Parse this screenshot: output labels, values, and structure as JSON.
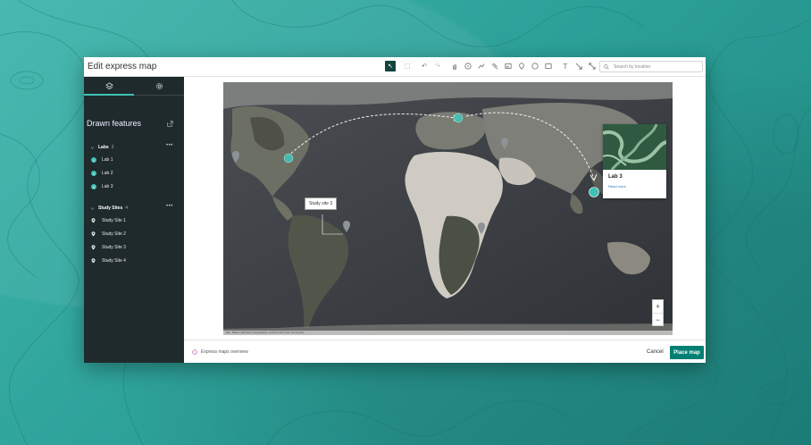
{
  "window": {
    "title": "Edit express map"
  },
  "toolbar": {
    "tools": [
      {
        "name": "select-tool-icon",
        "glyph": "↖",
        "active": true
      },
      {
        "name": "multi-select-tool-icon",
        "glyph": "⬚",
        "active": false
      },
      {
        "name": "undo-icon",
        "glyph": "↶",
        "active": false
      },
      {
        "name": "redo-icon",
        "glyph": "↷",
        "active": false
      },
      {
        "name": "pan-hand-icon",
        "glyph": "✋",
        "active": false
      },
      {
        "name": "numbered-point-icon",
        "glyph": "①",
        "active": false
      },
      {
        "name": "line-tool-icon",
        "glyph": "⟋",
        "active": false
      },
      {
        "name": "highlighter-icon",
        "glyph": "✎",
        "active": false
      },
      {
        "name": "image-tool-icon",
        "glyph": "▨",
        "active": false
      },
      {
        "name": "marker-pin-icon",
        "glyph": "⌖",
        "active": false
      },
      {
        "name": "circle-tool-icon",
        "glyph": "○",
        "active": false
      },
      {
        "name": "rectangle-tool-icon",
        "glyph": "▭",
        "active": false
      },
      {
        "name": "text-tool-icon",
        "glyph": "T",
        "active": false
      },
      {
        "name": "arrow-tool-icon",
        "glyph": "↘",
        "active": false
      },
      {
        "name": "measure-tool-icon",
        "glyph": "⤡",
        "active": false
      }
    ],
    "search_placeholder": "Search by location"
  },
  "sidebar": {
    "tabs": [
      {
        "name": "layers-icon",
        "active": true
      },
      {
        "name": "settings-icon",
        "active": false
      }
    ],
    "heading": "Drawn features",
    "groups": [
      {
        "label": "Labs",
        "count": "3",
        "items": [
          {
            "label": "Lab 1",
            "marker": "1"
          },
          {
            "label": "Lab 2",
            "marker": "2"
          },
          {
            "label": "Lab 3",
            "marker": "3"
          }
        ]
      },
      {
        "label": "Study Sites",
        "count": "4",
        "items": [
          {
            "label": "Study Site 1"
          },
          {
            "label": "Study Site 2"
          },
          {
            "label": "Study Site 3"
          },
          {
            "label": "Study Site 4"
          }
        ]
      }
    ]
  },
  "map": {
    "callout_label": "Study site 3",
    "popup": {
      "title": "Lab 3",
      "link": "Read more"
    },
    "attribution": "Esri, Maxar, Earthstar Geographics, and the GIS User Community",
    "zoom_in": "+",
    "zoom_out": "−"
  },
  "footer": {
    "help_link": "Express maps overview",
    "cancel_label": "Cancel",
    "place_label": "Place map"
  },
  "colors": {
    "accent": "#3fc2b5",
    "primary_button": "#007f73",
    "sidebar_bg": "#1f2a2d",
    "background": "#2fa9a0"
  }
}
